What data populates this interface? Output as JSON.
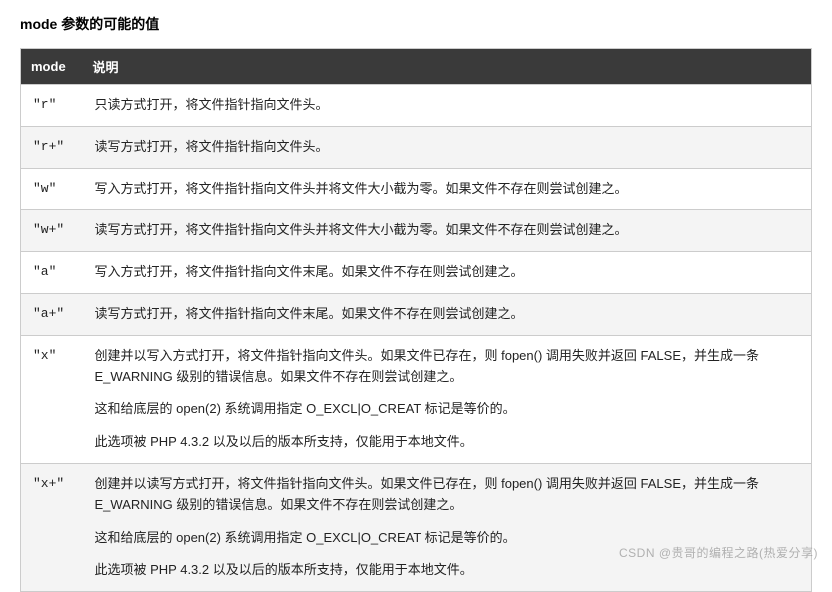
{
  "heading": "mode 参数的可能的值",
  "columns": {
    "mode": "mode",
    "desc": "说明"
  },
  "rows": [
    {
      "mode": "\"r\"",
      "desc": [
        "只读方式打开，将文件指针指向文件头。"
      ]
    },
    {
      "mode": "\"r+\"",
      "desc": [
        "读写方式打开，将文件指针指向文件头。"
      ]
    },
    {
      "mode": "\"w\"",
      "desc": [
        "写入方式打开，将文件指针指向文件头并将文件大小截为零。如果文件不存在则尝试创建之。"
      ]
    },
    {
      "mode": "\"w+\"",
      "desc": [
        "读写方式打开，将文件指针指向文件头并将文件大小截为零。如果文件不存在则尝试创建之。"
      ]
    },
    {
      "mode": "\"a\"",
      "desc": [
        "写入方式打开，将文件指针指向文件末尾。如果文件不存在则尝试创建之。"
      ]
    },
    {
      "mode": "\"a+\"",
      "desc": [
        "读写方式打开，将文件指针指向文件末尾。如果文件不存在则尝试创建之。"
      ]
    },
    {
      "mode": "\"x\"",
      "desc": [
        "创建并以写入方式打开，将文件指针指向文件头。如果文件已存在，则 fopen() 调用失败并返回 FALSE，并生成一条 E_WARNING 级别的错误信息。如果文件不存在则尝试创建之。",
        "这和给底层的 open(2) 系统调用指定 O_EXCL|O_CREAT 标记是等价的。",
        "此选项被 PHP 4.3.2 以及以后的版本所支持，仅能用于本地文件。"
      ]
    },
    {
      "mode": "\"x+\"",
      "desc": [
        "创建并以读写方式打开，将文件指针指向文件头。如果文件已存在，则 fopen() 调用失败并返回 FALSE，并生成一条 E_WARNING 级别的错误信息。如果文件不存在则尝试创建之。",
        "这和给底层的 open(2) 系统调用指定 O_EXCL|O_CREAT 标记是等价的。",
        "此选项被 PHP 4.3.2 以及以后的版本所支持，仅能用于本地文件。"
      ]
    }
  ],
  "watermark": "CSDN @贵哥的编程之路(热爱分享)"
}
